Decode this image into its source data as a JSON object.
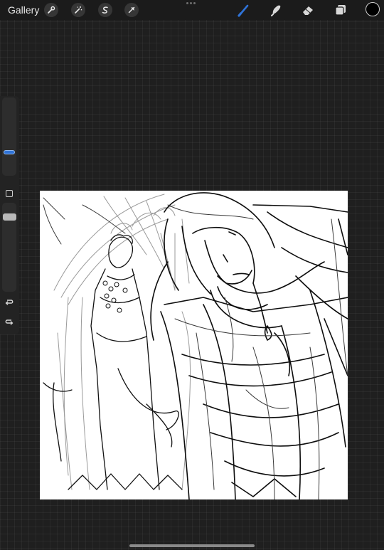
{
  "topbar": {
    "gallery_label": "Gallery",
    "left_tools": [
      "wrench-icon",
      "magic-wand-icon",
      "selection-s-icon",
      "transform-arrow-icon"
    ],
    "right_tools": [
      "brush-icon",
      "smudge-icon",
      "eraser-icon",
      "layers-icon"
    ],
    "active_tool": "brush-icon",
    "accent_color": "#2f73d8",
    "current_color": "#000000"
  },
  "sidebar": {
    "brush_size_level": 0.3,
    "opacity_level": 0.15
  },
  "canvas": {
    "background": "#ffffff",
    "content": "sketch"
  }
}
